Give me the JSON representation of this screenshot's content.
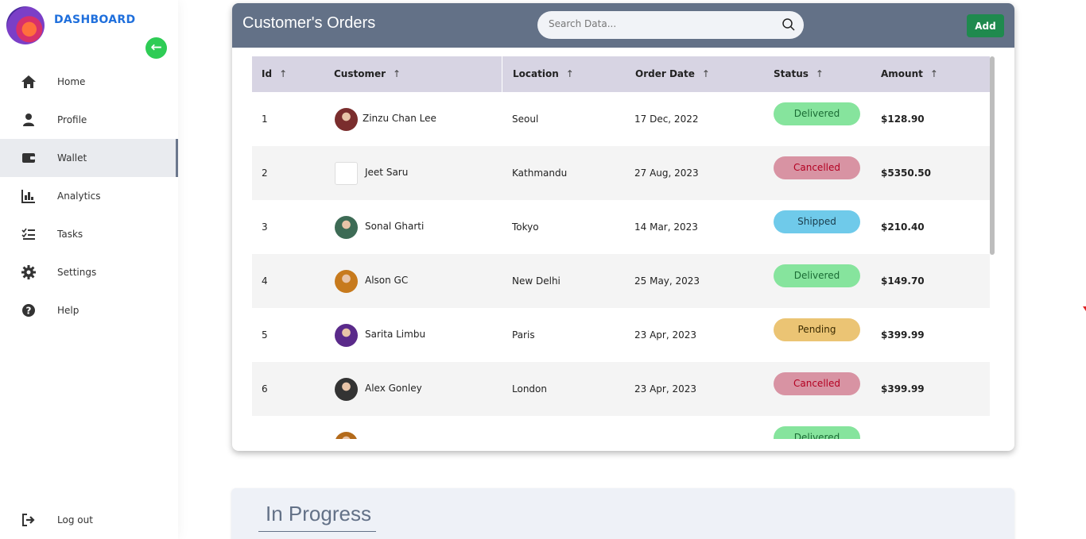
{
  "sidebar": {
    "brand": "DASHBOARD",
    "back_icon": "arrow-left-icon",
    "items": [
      {
        "label": "Home",
        "icon": "home-icon"
      },
      {
        "label": "Profile",
        "icon": "user-icon"
      },
      {
        "label": "Wallet",
        "icon": "wallet-icon",
        "active": true
      },
      {
        "label": "Analytics",
        "icon": "chart-icon"
      },
      {
        "label": "Tasks",
        "icon": "tasks-icon"
      },
      {
        "label": "Settings",
        "icon": "gear-icon"
      },
      {
        "label": "Help",
        "icon": "help-icon"
      }
    ],
    "logout": {
      "label": "Log out",
      "icon": "logout-icon"
    }
  },
  "orders": {
    "title": "Customer's Orders",
    "search_placeholder": "Search Data...",
    "add_label": "Add",
    "columns": [
      "Id",
      "Customer",
      "Location",
      "Order Date",
      "Status",
      "Amount"
    ],
    "sort_arrow": "↑",
    "rows": [
      {
        "id": "1",
        "customer": "Zinzu Chan Lee",
        "location": "Seoul",
        "date": "17 Dec, 2022",
        "status": "Delivered",
        "amount": "$128.90"
      },
      {
        "id": "2",
        "customer": "Jeet Saru",
        "location": "Kathmandu",
        "date": "27 Aug, 2023",
        "status": "Cancelled",
        "amount": "$5350.50"
      },
      {
        "id": "3",
        "customer": "Sonal Gharti",
        "location": "Tokyo",
        "date": "14 Mar, 2023",
        "status": "Shipped",
        "amount": "$210.40"
      },
      {
        "id": "4",
        "customer": "Alson GC",
        "location": "New Delhi",
        "date": "25 May, 2023",
        "status": "Delivered",
        "amount": "$149.70"
      },
      {
        "id": "5",
        "customer": "Sarita Limbu",
        "location": "Paris",
        "date": "23 Apr, 2023",
        "status": "Pending",
        "amount": "$399.99"
      },
      {
        "id": "6",
        "customer": "Alex Gonley",
        "location": "London",
        "date": "23 Apr, 2023",
        "status": "Cancelled",
        "amount": "$399.99"
      },
      {
        "id": "",
        "customer": "",
        "location": "",
        "date": "",
        "status": "Delivered",
        "amount": ""
      }
    ]
  },
  "status_colors": {
    "Delivered": {
      "bg": "#86e49d",
      "fg": "#1a6b34"
    },
    "Cancelled": {
      "bg": "#d893a3",
      "fg": "#b30021"
    },
    "Shipped": {
      "bg": "#6fcaea",
      "fg": "#1a3b4a"
    },
    "Pending": {
      "bg": "#ebc474",
      "fg": "#3a2a00"
    }
  },
  "in_progress": {
    "title": "In Progress"
  },
  "theme": {
    "header": "#637187",
    "brand": "#1f6fdc",
    "add_button": "#1f8a4e",
    "back_button": "#2ecc55"
  }
}
